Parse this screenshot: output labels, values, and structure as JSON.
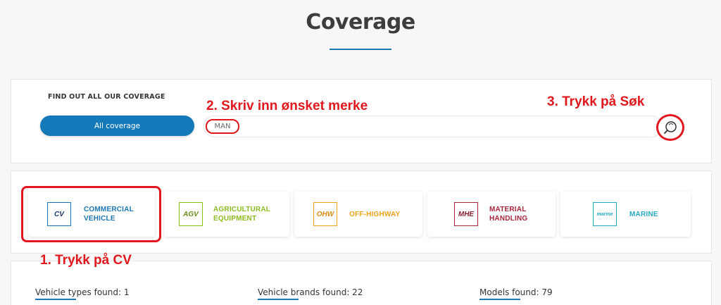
{
  "page": {
    "title": "Coverage"
  },
  "search": {
    "find_label": "FIND OUT ALL OUR COVERAGE",
    "all_button": "All coverage",
    "value": "MAN",
    "search_icon": "search-icon"
  },
  "annotations": {
    "step1": "1. Trykk på CV",
    "step2": "2. Skriv inn ønsket merke",
    "step3": "3. Trykk på Søk",
    "color": "#e0181e"
  },
  "categories": [
    {
      "logo": "CV",
      "label": "COMMERCIAL VEHICLE",
      "color": "#1a77b3"
    },
    {
      "logo": "AGV",
      "label": "AGRICULTURAL EQUIPMENT",
      "color": "#8cbc1f"
    },
    {
      "logo": "OHW",
      "label": "OFF-HIGHWAY",
      "color": "#f0a21d"
    },
    {
      "logo": "MHE",
      "label": "MATERIAL HANDLING",
      "color": "#a8263b"
    },
    {
      "logo": "marine",
      "label": "MARINE",
      "color": "#27a9c5"
    }
  ],
  "stats": {
    "vehicle_types": "Vehicle types found: 1",
    "vehicle_brands": "Vehicle brands found: 22",
    "models": "Models found: 79"
  },
  "colors": {
    "accent": "#1479b8",
    "annotation": "#e0181e"
  }
}
